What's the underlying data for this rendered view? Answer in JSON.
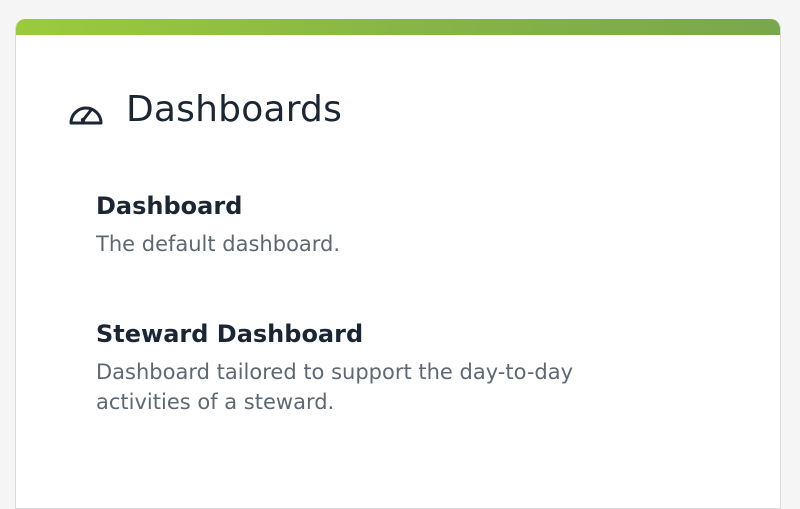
{
  "colors": {
    "accent_start": "#9bcb3c",
    "accent_end": "#78a84b",
    "title_text": "#1b2634",
    "desc_text": "#5d6875"
  },
  "header": {
    "icon": "gauge-icon",
    "title": "Dashboards"
  },
  "dashboards": [
    {
      "title": "Dashboard",
      "description": "The default dashboard."
    },
    {
      "title": "Steward Dashboard",
      "description": "Dashboard tailored to support the day-to-day activities of a steward."
    }
  ]
}
